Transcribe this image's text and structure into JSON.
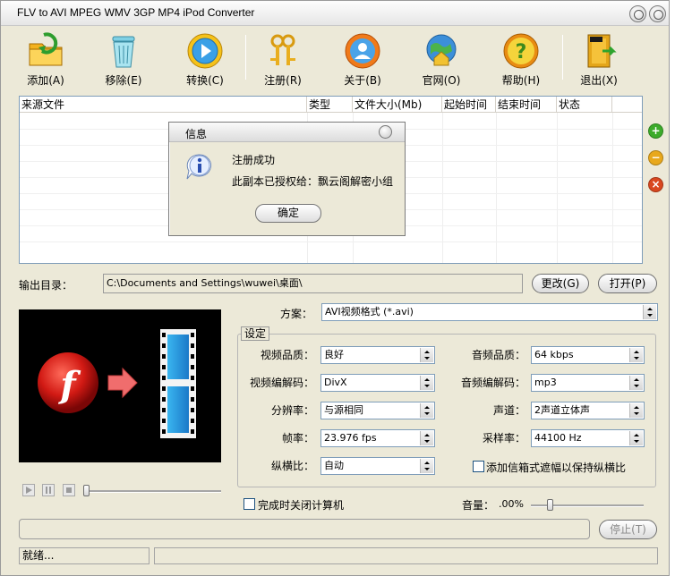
{
  "window": {
    "title": "FLV to AVI MPEG WMV 3GP MP4 iPod Converter"
  },
  "toolbar": {
    "add": "添加(A)",
    "remove": "移除(E)",
    "convert": "转换(C)",
    "register": "注册(R)",
    "about": "关于(B)",
    "website": "官网(O)",
    "help": "帮助(H)",
    "exit": "退出(X)"
  },
  "filelist": {
    "columns": [
      "来源文件",
      "类型",
      "文件大小(Mb)",
      "起始时间",
      "结束时间",
      "状态"
    ]
  },
  "dialog": {
    "title": "信息",
    "line1": "注册成功",
    "line2": "此副本已授权给：飘云阁解密小组",
    "ok": "确定"
  },
  "output": {
    "label": "输出目录：",
    "path": "C:\\Documents and Settings\\wuwei\\桌面\\",
    "change": "更改(G)",
    "open": "打开(P)"
  },
  "scheme": {
    "label": "方案：",
    "value": "AVI视频格式 (*.avi)"
  },
  "settings": {
    "legend": "设定",
    "video_quality_label": "视频品质：",
    "video_quality": "良好",
    "audio_quality_label": "音频品质：",
    "audio_quality": "64  kbps",
    "video_codec_label": "视频编解码：",
    "video_codec": "DivX",
    "audio_codec_label": "音频编解码：",
    "audio_codec": "mp3",
    "resolution_label": "分辨率：",
    "resolution": "与源相同",
    "channels_label": "声道：",
    "channels": "2声道立体声",
    "framerate_label": "帧率：",
    "framerate": "23.976 fps",
    "samplerate_label": "采样率：",
    "samplerate": "44100 Hz",
    "aspect_label": "纵横比：",
    "aspect": "自动",
    "letterbox_label": "添加信箱式遮幅以保持纵横比"
  },
  "bottom": {
    "shutdown_label": "完成时关闭计算机",
    "volume_label": "音量：",
    "volume_value": ".00%",
    "stop": "停止(T)"
  },
  "status": {
    "text": "就绪..."
  },
  "colors": {
    "window_bg": "#ece9d8",
    "accent_green": "#3cab2a",
    "accent_yellow": "#e8a81c",
    "accent_red": "#d9471f"
  }
}
